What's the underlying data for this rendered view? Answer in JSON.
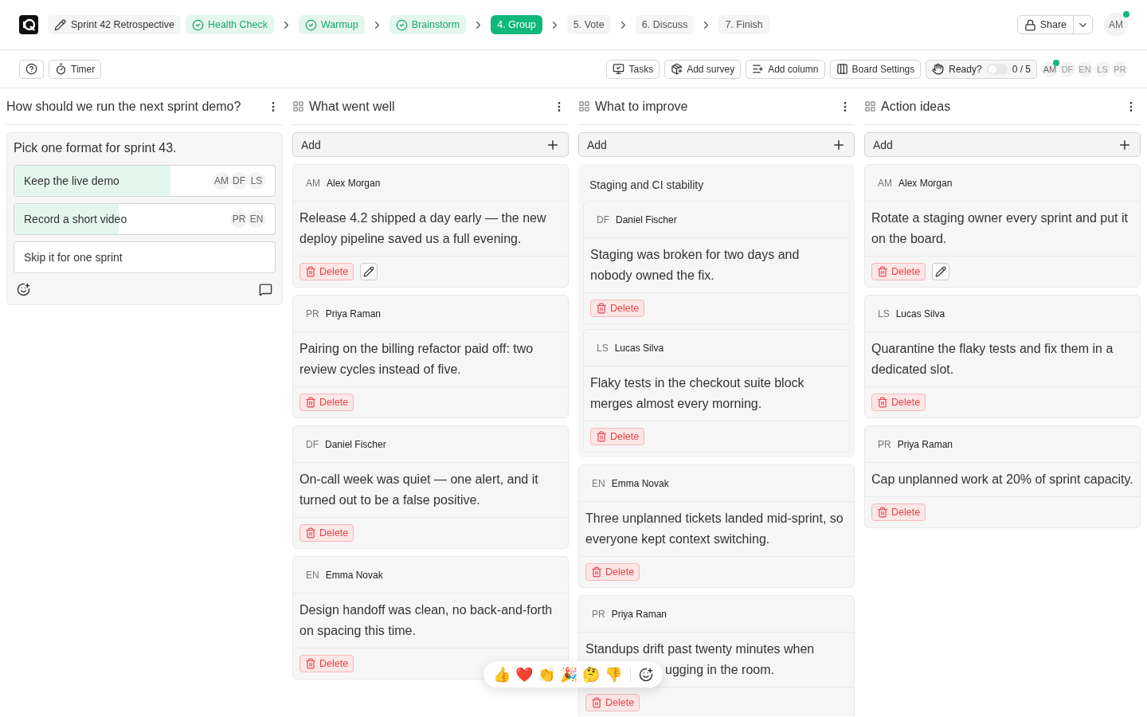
{
  "header": {
    "board_title": "Sprint 42 Retrospective",
    "steps": [
      {
        "label": "Health Check",
        "done": true,
        "selected": false
      },
      {
        "label": "Warmup",
        "done": true,
        "selected": false
      },
      {
        "label": "Brainstorm",
        "done": true,
        "selected": false
      },
      {
        "label": "4. Group",
        "done": false,
        "selected": true
      },
      {
        "label": "5. Vote",
        "done": false,
        "selected": false
      },
      {
        "label": "6. Discuss",
        "done": false,
        "selected": false
      },
      {
        "label": "7. Finish",
        "done": false,
        "selected": false
      }
    ],
    "share": "Share",
    "user": {
      "initials": "AM",
      "online": true
    }
  },
  "toolbar": {
    "left": [
      "Timer"
    ],
    "right": [
      {
        "label": "Tasks",
        "kind": "tasks"
      },
      {
        "label": "Add survey",
        "kind": "survey"
      },
      {
        "label": "Add column",
        "kind": "column"
      },
      {
        "label": "Board Settings",
        "kind": "settings"
      }
    ],
    "ready": {
      "label": "Ready?",
      "on": false,
      "count": "0 / 5"
    },
    "participants": [
      {
        "initials": "AM",
        "online": true
      },
      {
        "initials": "DF",
        "online": false
      },
      {
        "initials": "EN",
        "online": false
      },
      {
        "initials": "LS",
        "online": false
      },
      {
        "initials": "PR",
        "online": false
      }
    ]
  },
  "poll": {
    "title": "How should we run the next sprint demo?",
    "question": "Pick one format for sprint 43.",
    "options": [
      {
        "label": "Keep the live demo",
        "level": 0.6,
        "voters": [
          "AM",
          "DF",
          "LS"
        ]
      },
      {
        "label": "Record a short video",
        "level": 0.4,
        "voters": [
          "PR",
          "EN"
        ]
      },
      {
        "label": "Skip it for one sprint"
      }
    ]
  },
  "columns": [
    {
      "title": "What went well",
      "add": "Add",
      "items": [
        {
          "kind": "card",
          "initials": "AM",
          "author": "Alex Morgan",
          "lines": [
            "Release 4.2 shipped a day early — the new deploy pipeline saved us a full evening."
          ],
          "delete": "Delete",
          "editable": true
        },
        {
          "kind": "card",
          "initials": "PR",
          "author": "Priya Raman",
          "lines": [
            "Pairing on the billing refactor paid off: two review cycles instead of five."
          ],
          "delete": "Delete",
          "editable": false
        },
        {
          "kind": "card",
          "initials": "DF",
          "author": "Daniel Fischer",
          "lines": [
            "On-call week was quiet — one alert, and it turned out to be a false positive."
          ],
          "delete": "Delete",
          "editable": false
        },
        {
          "kind": "card",
          "initials": "EN",
          "author": "Emma Novak",
          "lines": [
            "Design handoff was clean, no back-and-forth on spacing this time."
          ],
          "delete": "Delete",
          "editable": false
        }
      ]
    },
    {
      "title": "What to improve",
      "add": "Add",
      "items": [
        {
          "kind": "group",
          "title": "Staging and CI stability",
          "children": [
            {
              "kind": "card",
              "initials": "DF",
              "author": "Daniel Fischer",
              "lines": [
                "Staging was broken for two days and nobody owned the fix."
              ],
              "delete": "Delete",
              "editable": false
            },
            {
              "kind": "card",
              "initials": "LS",
              "author": "Lucas Silva",
              "lines": [
                "Flaky tests in the checkout suite block merges almost every morning."
              ],
              "delete": "Delete",
              "editable": false
            }
          ]
        },
        {
          "kind": "card",
          "initials": "EN",
          "author": "Emma Novak",
          "lines": [
            "Three unplanned tickets landed mid-sprint, so everyone kept context switching."
          ],
          "delete": "Delete",
          "editable": false
        },
        {
          "kind": "card",
          "initials": "PR",
          "author": "Priya Raman",
          "lines": [
            "Standups drift past twenty minutes when",
            "ugging in the room."
          ],
          "delete": "Delete",
          "editable": false,
          "reactions": [
            "👍",
            "❤️",
            "👏",
            "🎉",
            "🤔",
            "👎"
          ]
        }
      ]
    },
    {
      "title": "Action ideas",
      "add": "Add",
      "items": [
        {
          "kind": "card",
          "initials": "AM",
          "author": "Alex Morgan",
          "lines": [
            "Rotate a staging owner every sprint and put it on the board."
          ],
          "delete": "Delete",
          "editable": true
        },
        {
          "kind": "card",
          "initials": "LS",
          "author": "Lucas Silva",
          "lines": [
            "Quarantine the flaky tests and fix them in a dedicated slot."
          ],
          "delete": "Delete",
          "editable": false
        },
        {
          "kind": "card",
          "initials": "PR",
          "author": "Priya Raman",
          "lines": [
            "Cap unplanned work at 20% of sprint capacity."
          ],
          "delete": "Delete",
          "editable": false
        }
      ]
    }
  ]
}
